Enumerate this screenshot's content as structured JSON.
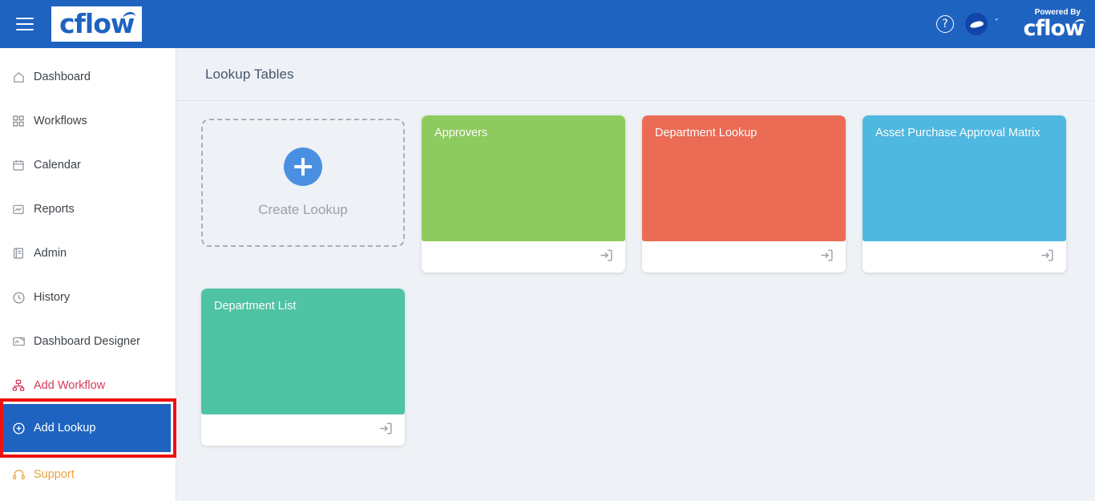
{
  "header": {
    "menu_icon": "hamburger-icon",
    "logo_text": "cflow",
    "help_icon": "?",
    "avatar_icon": "avatar-swoosh",
    "dropdown_icon": "ˇ",
    "powered_by_label": "Powered By",
    "powered_brand": "cflow",
    "bg_color": "#1f63c0"
  },
  "sidebar": {
    "items": [
      {
        "label": "Dashboard",
        "icon": "home-icon",
        "state": "default"
      },
      {
        "label": "Workflows",
        "icon": "grid-icon",
        "state": "default"
      },
      {
        "label": "Calendar",
        "icon": "calendar-icon",
        "state": "default"
      },
      {
        "label": "Reports",
        "icon": "report-icon",
        "state": "default"
      },
      {
        "label": "Admin",
        "icon": "book-icon",
        "state": "default"
      },
      {
        "label": "History",
        "icon": "clock-icon",
        "state": "default"
      },
      {
        "label": "Dashboard Designer",
        "icon": "dashboard-designer-icon",
        "state": "default"
      },
      {
        "label": "Add Workflow",
        "icon": "add-workflow-icon",
        "state": "red"
      },
      {
        "label": "Add Lookup",
        "icon": "plus-circle-icon",
        "state": "active"
      },
      {
        "label": "Support",
        "icon": "headset-icon",
        "state": "orange"
      }
    ],
    "active_color": "#1f63c0",
    "red_color": "#d6395c",
    "orange_color": "#e8a33d",
    "annotation_color": "#ee1111"
  },
  "main": {
    "page_title": "Lookup Tables",
    "create_card": {
      "label": "Create Lookup",
      "icon": "plus-icon",
      "accent_color": "#4a90e2"
    },
    "cards": [
      {
        "title": "Approvers",
        "color": "#8ecb5f",
        "open_icon": "open-in-icon"
      },
      {
        "title": "Department Lookup",
        "color": "#ec6b55",
        "open_icon": "open-in-icon"
      },
      {
        "title": "Asset Purchase Approval Matrix",
        "color": "#4fb8e0",
        "open_icon": "open-in-icon"
      },
      {
        "title": "Department List",
        "color": "#4ec4a4",
        "open_icon": "open-in-icon"
      }
    ],
    "background_color": "#eef1f5"
  }
}
